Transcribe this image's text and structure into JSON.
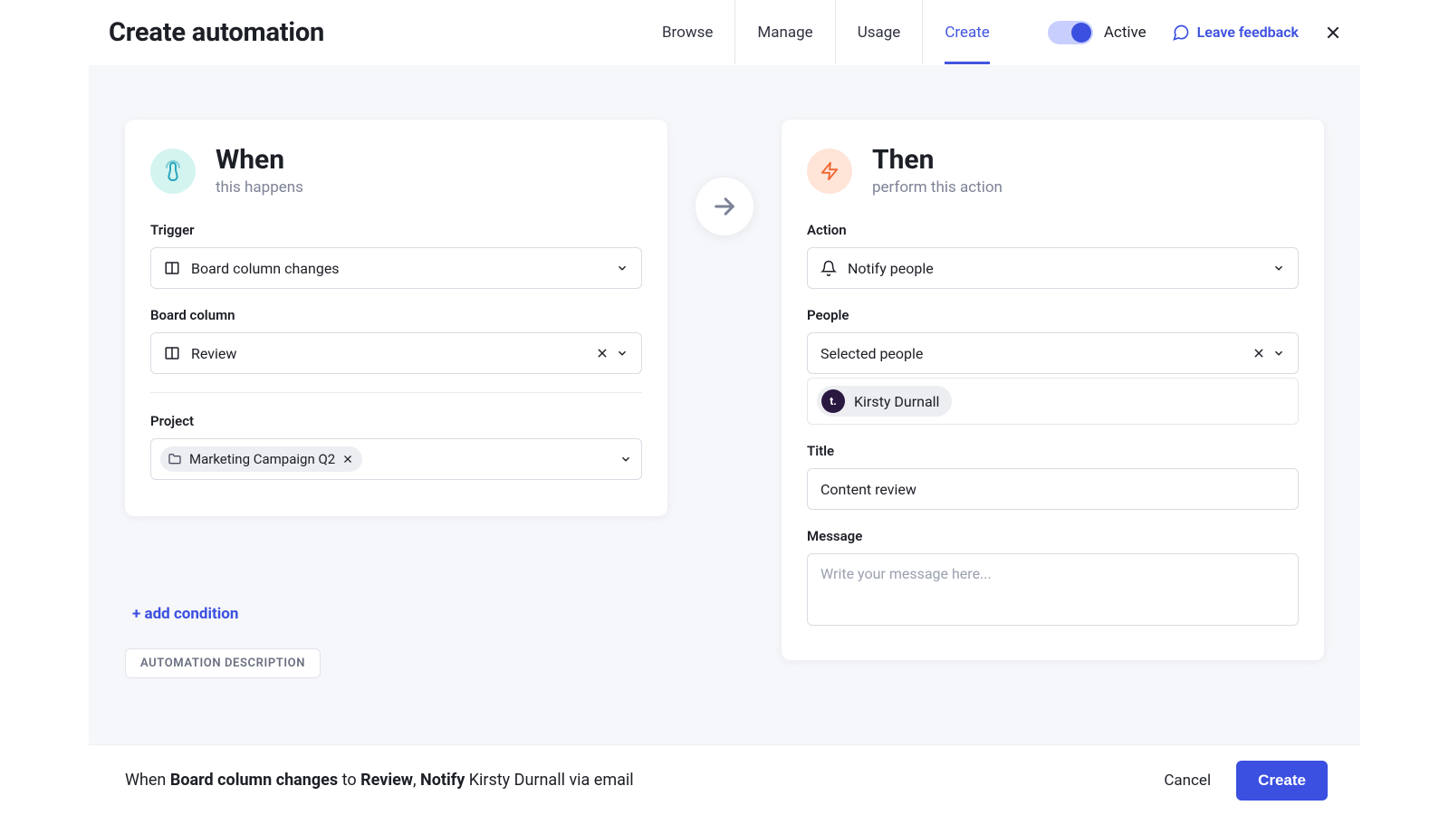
{
  "header": {
    "title": "Create automation",
    "tabs": [
      "Browse",
      "Manage",
      "Usage",
      "Create"
    ],
    "active_tab": "Create",
    "toggle_label": "Active",
    "feedback_label": "Leave feedback"
  },
  "when": {
    "title": "When",
    "subtitle": "this happens",
    "trigger_label": "Trigger",
    "trigger_value": "Board column changes",
    "board_column_label": "Board column",
    "board_column_value": "Review",
    "project_label": "Project",
    "project_chip": "Marketing Campaign Q2"
  },
  "then": {
    "title": "Then",
    "subtitle": "perform this action",
    "action_label": "Action",
    "action_value": "Notify people",
    "people_label": "People",
    "people_value": "Selected people",
    "people_chip": "Kirsty Durnall",
    "people_avatar": "t.",
    "title_label": "Title",
    "title_value": "Content review",
    "message_label": "Message",
    "message_placeholder": "Write your message here..."
  },
  "add_condition": "+ add condition",
  "description_badge": "AUTOMATION DESCRIPTION",
  "summary": {
    "prefix": "When ",
    "b1": "Board column changes",
    "mid1": " to ",
    "b2": "Review",
    "mid2": ", ",
    "b3": "Notify",
    "suffix": " Kirsty Durnall via email"
  },
  "footer": {
    "cancel": "Cancel",
    "create": "Create"
  }
}
